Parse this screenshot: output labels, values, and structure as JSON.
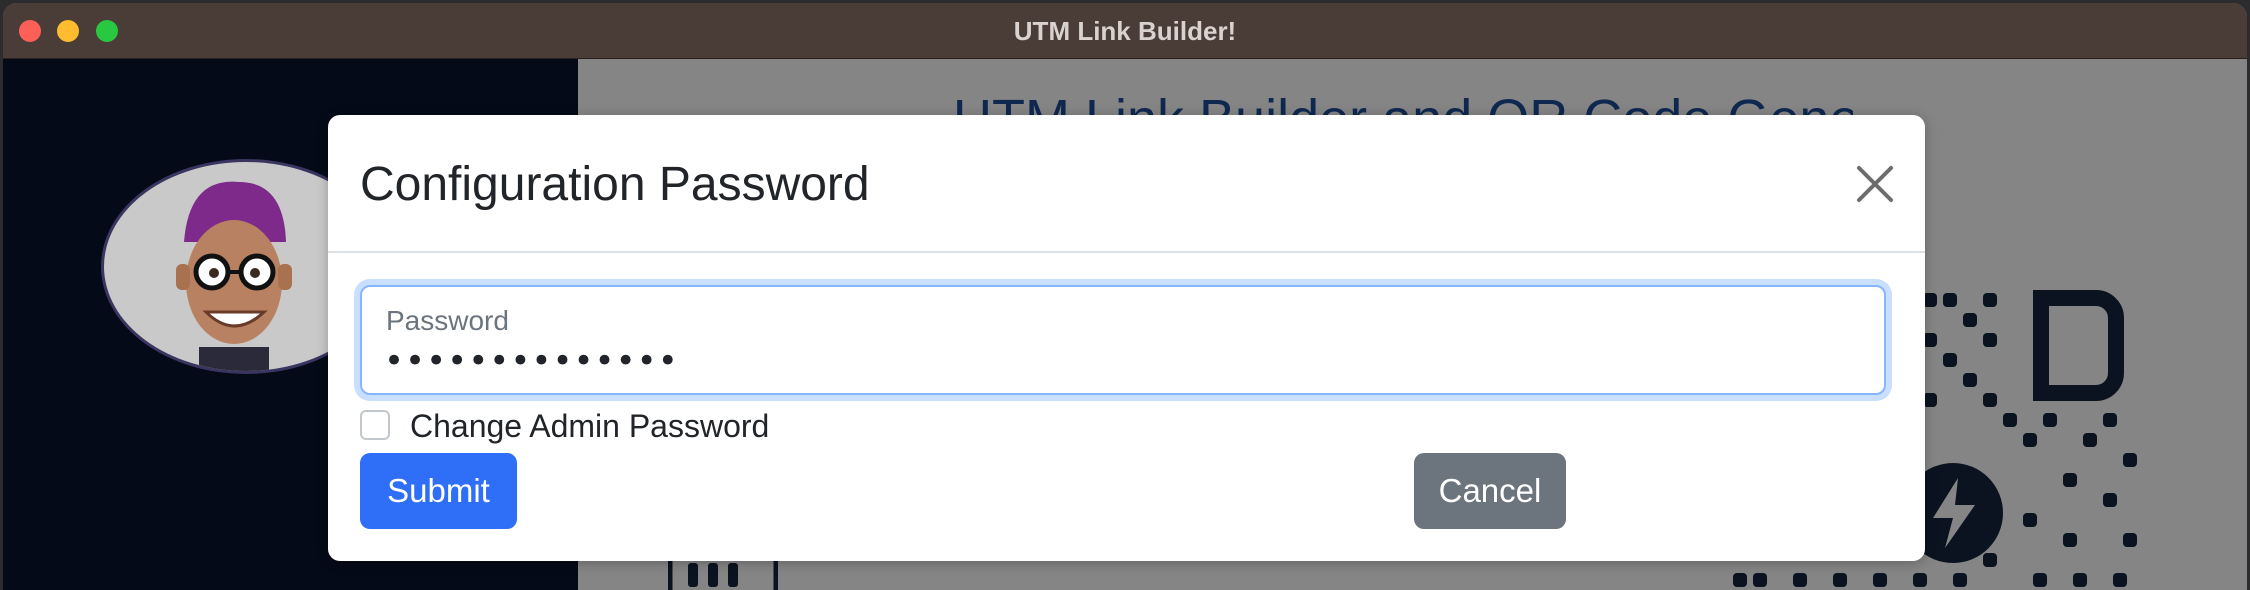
{
  "window": {
    "title": "UTM Link Builder!"
  },
  "background": {
    "heading": "UTM Link Builder and QR Code Generator"
  },
  "modal": {
    "title": "Configuration Password",
    "password_label": "Password",
    "password_value": "••••••••••••••",
    "checkbox_label": "Change Admin Password",
    "checkbox_checked": false,
    "submit_label": "Submit",
    "cancel_label": "Cancel"
  },
  "colors": {
    "primary": "#2f6ef6",
    "secondary": "#6c757d",
    "focus_ring": "#86b7fe"
  }
}
